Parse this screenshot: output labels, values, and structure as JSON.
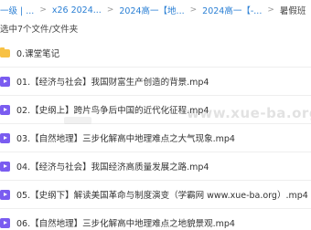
{
  "breadcrumb": {
    "items": [
      {
        "label": "一级 | ..."
      },
      {
        "label": "x26 2024..."
      },
      {
        "label": "2024高一【地..."
      },
      {
        "label": "2024高一【-..."
      },
      {
        "label": "暑假班"
      }
    ],
    "separator": ">"
  },
  "selection": {
    "status": "选中7个文件/文件夹"
  },
  "files": [
    {
      "name": "0.课堂笔记",
      "icon": "folder-icon"
    },
    {
      "name": "01.【经济与社会】我国财富生产创造的背景.mp4",
      "icon": "video-file-icon"
    },
    {
      "name": "02.【史纲上】跨片鸟争后中国的近代化征程.mp4",
      "icon": "video-file-icon"
    },
    {
      "name": "03.【自然地理】三步化解高中地理难点之大气现象.mp4",
      "icon": "video-file-icon"
    },
    {
      "name": "04.【经济与社会】我国经济高质量发展之路.mp4",
      "icon": "video-file-icon"
    },
    {
      "name": "05.【史纲下】解读美国革命与制度演变（学霸网 www.xue-ba.org）.mp4",
      "icon": "video-file-icon"
    },
    {
      "name": "06.【自然地理】三步化解高中地理难点之地貌景观.mp4",
      "icon": "video-file-icon"
    }
  ],
  "watermark": {
    "text": "www.xue-ba.org"
  },
  "colors": {
    "link": "#2a7fd4",
    "folder": "#f7c144",
    "video": "#7a5cf0"
  }
}
